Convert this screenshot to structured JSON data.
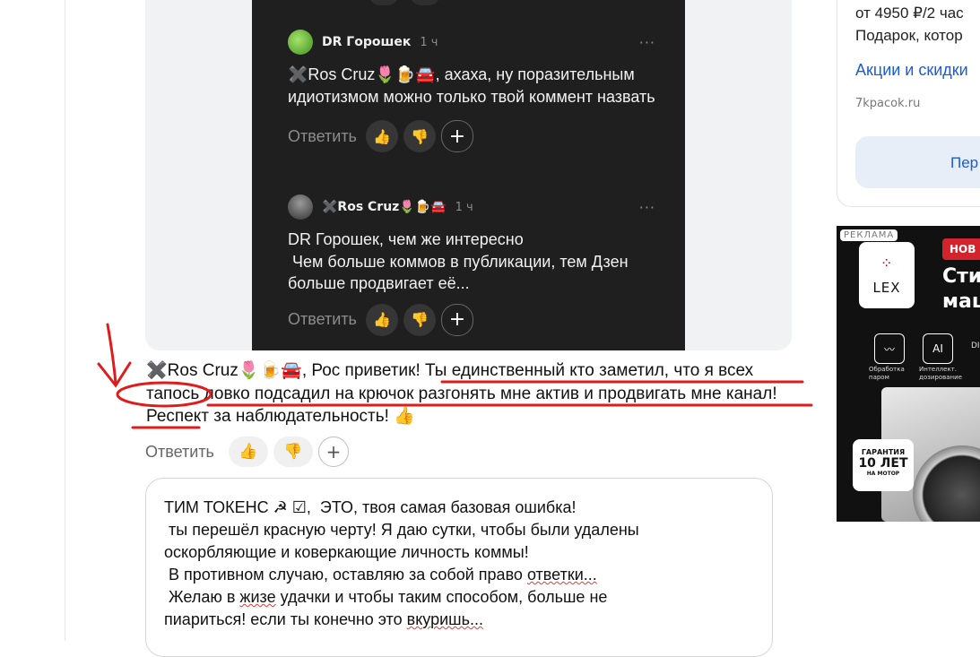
{
  "embed": {
    "comment1": {
      "author": "DR Горошек",
      "time": "1 ч",
      "more": "···",
      "text": "✖️Ros Cruz🌷🍺🚘, ахаха, ну поразительным идиотизмом можно только твой коммент назвать",
      "reply": "Ответить",
      "like": "👍",
      "dislike": "👎",
      "plus": "+"
    },
    "comment2": {
      "author": "✖️Ros Cruz🌷🍺🚘",
      "time": "1 ч",
      "more": "···",
      "text": "DR Горошек, чем же интересно\n Чем больше коммов в публикации, тем Дзен больше продвигает её...",
      "reply": "Ответить",
      "like": "👍",
      "dislike": "👎",
      "plus": "+"
    }
  },
  "comment": {
    "mention": "✖️Ros Cruz🌷🍺🚘",
    "text": ", Рос приветик! Ты единственный кто заметил, что я всех тапось ловко подсадил на крючок разгонять мне актив и продвигать мне канал! Респект за наблюдательность! 👍",
    "reply": "Ответить",
    "like": "👍",
    "dislike": "👎",
    "plus": "+"
  },
  "reply_box": {
    "line1": "ТИМ ТОКЕНС ☭ ☑,  ЭТО, твоя самая базовая ошибка!",
    "line2": " ты перешёл красную черту! Я даю сутки, чтобы были удалены",
    "line3": "оскорбляющие и коверкающие личность коммы!",
    "line4a": " В противном случаю, оставляю за собой право ",
    "line4b": "ответки...",
    "line5a": " Желаю в ",
    "line5b": "жизе",
    "line5c": " удачки и чтобы таким способом, больше не",
    "line6a": "пиариться! если ты конечно это ",
    "line6b": "вкуришь..."
  },
  "promo": {
    "line1": "от 4950 ₽/2 час",
    "line2": "Подарок, котор",
    "link": "Акции и скидки",
    "domain": "7kpacok.ru",
    "button": "Пер"
  },
  "ad": {
    "tag": "РЕКЛАМА",
    "brand": "LEX",
    "badge": "НОВ",
    "headline1": "Сти",
    "headline2": "маш",
    "feature1": "Обработка паром",
    "feature2": "Интеллект. дозирование",
    "feature3": "DIR IN",
    "guarantee1": "ГАРАНТИЯ",
    "guarantee2": "10 ЛЕТ",
    "guarantee3": "НА МОТОР"
  },
  "colors": {
    "annotation": "#e01b1b",
    "link": "#1a5adb",
    "dark_bg": "#1f1f1f"
  }
}
